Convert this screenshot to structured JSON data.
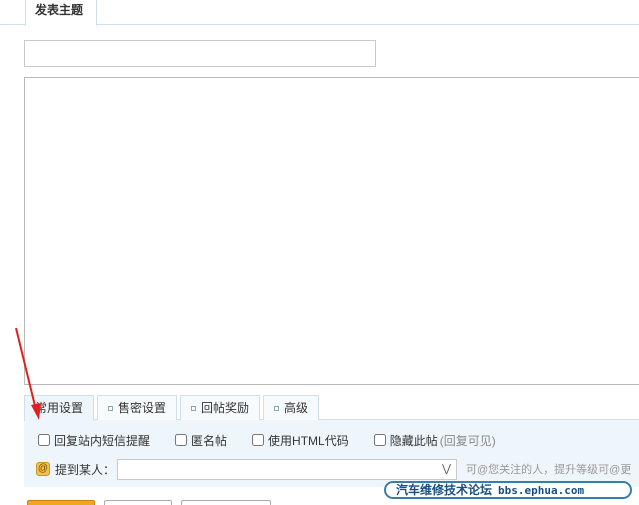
{
  "header": {
    "tab_label": "发表主题"
  },
  "subject": {
    "value": "",
    "placeholder": ""
  },
  "options": {
    "tabs": [
      {
        "label": "常用设置"
      },
      {
        "label": "售密设置"
      },
      {
        "label": "回帖奖励"
      },
      {
        "label": "高级"
      }
    ],
    "checks": [
      {
        "label": "回复站内短信提醒"
      },
      {
        "label": "匿名帖"
      },
      {
        "label": "使用HTML代码"
      },
      {
        "label": "隐藏此帖"
      }
    ],
    "hide_hint": "(回复可见)",
    "mention_label": "提到某人：",
    "mention_value": "",
    "mention_hint": "可@您关注的人，提升等级可@更"
  },
  "watermark": {
    "site": "汽车维修技术论坛",
    "url": "bbs.ephua.com"
  },
  "colors": {
    "accent_border": "#cde0ec",
    "panel_bg": "#eef6fb",
    "submit_orange": "#f0a71c",
    "arrow_red": "#e02020"
  }
}
